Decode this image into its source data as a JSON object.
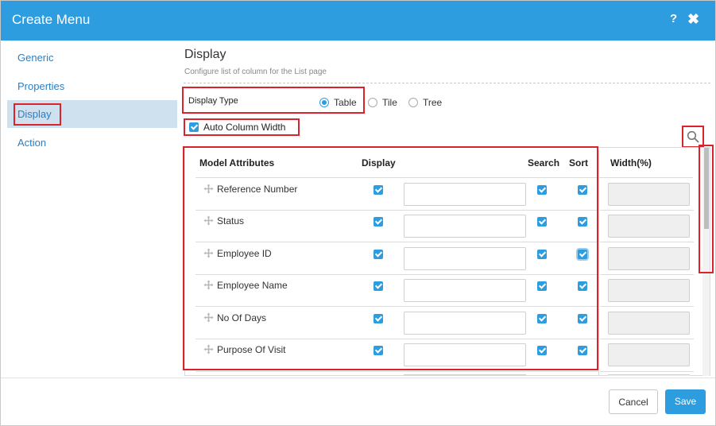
{
  "dialog": {
    "title": "Create Menu",
    "help_label": "?",
    "close_label": "✖"
  },
  "sidebar": {
    "items": [
      {
        "label": "Generic"
      },
      {
        "label": "Properties"
      },
      {
        "label": "Display"
      },
      {
        "label": "Action"
      }
    ],
    "active": "Display"
  },
  "content": {
    "title": "Display",
    "subtitle": "Configure list of column for the List page",
    "display_type": {
      "label": "Display Type",
      "options": [
        "Table",
        "Tile",
        "Tree"
      ],
      "selected": "Table"
    },
    "auto_column_width": {
      "label": "Auto Column Width",
      "checked": true
    }
  },
  "table": {
    "headers": {
      "model_attributes": "Model Attributes",
      "display": "Display",
      "search": "Search",
      "sort": "Sort",
      "width": "Width(%)"
    },
    "rows": [
      {
        "name": "Reference Number",
        "display": true,
        "label_value": "",
        "search": true,
        "sort": true,
        "width": ""
      },
      {
        "name": "Status",
        "display": true,
        "label_value": "",
        "search": true,
        "sort": true,
        "width": ""
      },
      {
        "name": "Employee ID",
        "display": true,
        "label_value": "",
        "search": true,
        "sort": true,
        "width": ""
      },
      {
        "name": "Employee Name",
        "display": true,
        "label_value": "",
        "search": true,
        "sort": true,
        "width": ""
      },
      {
        "name": "No Of Days",
        "display": true,
        "label_value": "",
        "search": true,
        "sort": true,
        "width": ""
      },
      {
        "name": "Purpose Of Visit",
        "display": true,
        "label_value": "",
        "search": true,
        "sort": true,
        "width": ""
      }
    ]
  },
  "icons": {
    "search": "search-icon",
    "drag": "move-icon"
  },
  "colors": {
    "accent": "#2d9de0",
    "highlight": "#d9232d",
    "link": "#2d7fc0"
  },
  "footer": {
    "cancel_label": "Cancel",
    "save_label": "Save"
  }
}
